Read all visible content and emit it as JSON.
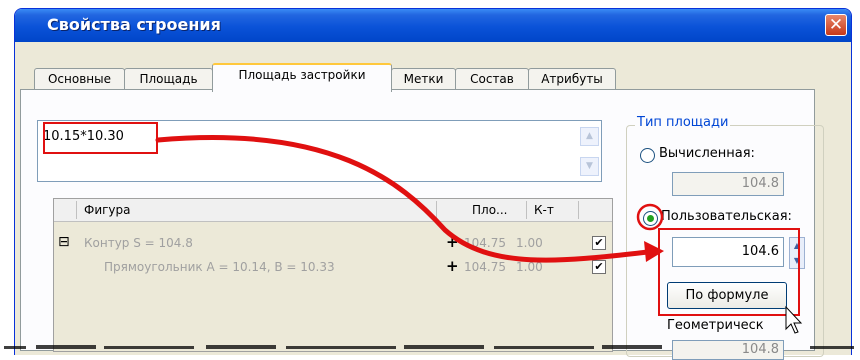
{
  "window": {
    "title": "Свойства строения",
    "close_glyph": "✕"
  },
  "tabs": [
    {
      "label": "Основные"
    },
    {
      "label": "Площадь"
    },
    {
      "label": "Площадь застройки"
    },
    {
      "label": "Метки"
    },
    {
      "label": "Состав"
    },
    {
      "label": "Атрибуты"
    }
  ],
  "active_tab": "Площадь застройки",
  "formula": {
    "value": "10.15*10.30"
  },
  "grid": {
    "columns": [
      "Фигура",
      "Пло...",
      "К-т"
    ],
    "rows": [
      {
        "expander": "⊟",
        "figure": "Контур S = 104.8",
        "add": "+",
        "area": "104.75",
        "k": "1.00",
        "checked": "✔"
      },
      {
        "expander": "",
        "figure": "Прямоугольник A = 10.14, B = 10.33",
        "add": "+",
        "area": "104.75",
        "k": "1.00",
        "checked": "✔"
      }
    ]
  },
  "area_type": {
    "legend": "Тип площади",
    "computed_label": "Вычисленная:",
    "computed_value": "104.8",
    "custom_label": "Пользовательская:",
    "custom_value": "104.6",
    "formula_button": "По формуле",
    "geometric_label": "Геометрическ",
    "geometric_value": "104.8"
  },
  "colors": {
    "annotation": "#e01010",
    "titlebar": "#0a52d8",
    "legend": "#0046d5"
  }
}
